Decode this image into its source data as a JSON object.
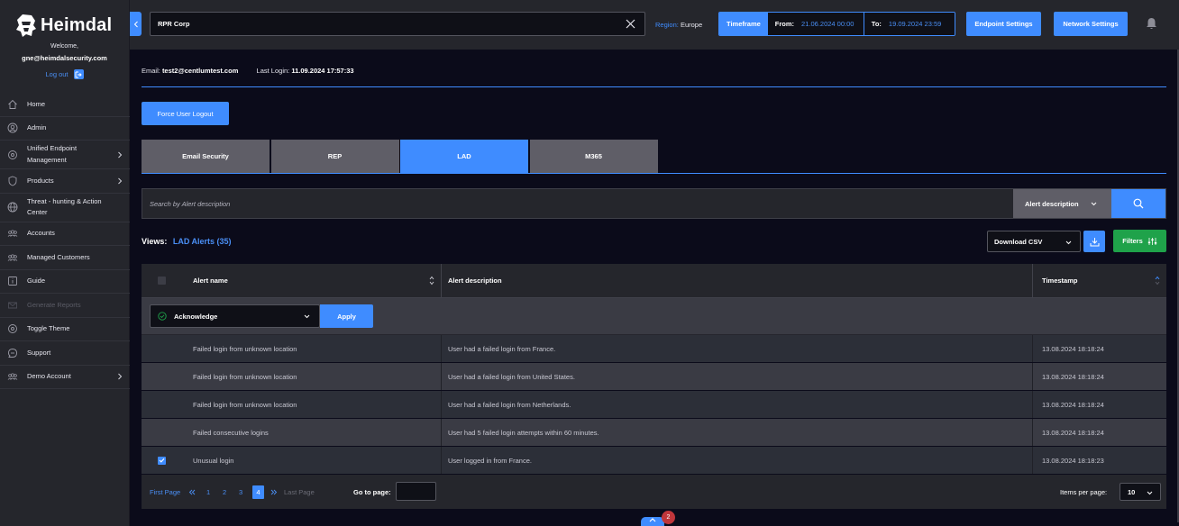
{
  "app": {
    "brand": "Heimdal",
    "welcome": "Welcome,",
    "email": "gne@heimdalsecurity.com",
    "logout": "Log out"
  },
  "nav": [
    {
      "label": "Home",
      "icon": "home-icon"
    },
    {
      "label": "Admin",
      "icon": "admin-icon"
    },
    {
      "label": "Unified Endpoint Management",
      "icon": "uem-icon",
      "chevron": true
    },
    {
      "label": "Products",
      "icon": "shield-icon",
      "chevron": true
    },
    {
      "label": "Threat - hunting & Action Center",
      "icon": "globe-icon"
    },
    {
      "label": "Accounts",
      "icon": "users-icon"
    },
    {
      "label": "Managed Customers",
      "icon": "customers-icon"
    },
    {
      "label": "Guide",
      "icon": "guide-icon"
    },
    {
      "label": "Generate Reports",
      "icon": "reports-icon",
      "disabled": true
    },
    {
      "label": "Toggle Theme",
      "icon": "theme-icon"
    },
    {
      "label": "Support",
      "icon": "support-icon"
    },
    {
      "label": "Demo Account",
      "icon": "demo-account-icon",
      "chevron": true
    }
  ],
  "topbar": {
    "company": "RPR Corp",
    "region_label": "Region:",
    "region_value": "Europe",
    "timeframe_label": "Timeframe",
    "from_label": "From:",
    "from_value": "21.06.2024 00:00",
    "to_label": "To:",
    "to_value": "19.09.2024 23:59",
    "endpoint_settings": "Endpoint Settings",
    "network_settings": "Network Settings"
  },
  "user_info": {
    "email_label": "Email:",
    "email_value": "test2@centlumtest.com",
    "last_login_label": "Last Login:",
    "last_login_value": "11.09.2024  17:57:33"
  },
  "force_logout": "Force User Logout",
  "tabs": [
    {
      "label": "Email Security",
      "active": false
    },
    {
      "label": "REP",
      "active": false
    },
    {
      "label": "LAD",
      "active": true
    },
    {
      "label": "M365",
      "active": false
    }
  ],
  "search": {
    "placeholder": "Search by Alert description",
    "field": "Alert description"
  },
  "views": {
    "label": "Views:",
    "value": "LAD Alerts (35)"
  },
  "download": {
    "label": "Download CSV"
  },
  "filters": {
    "label": "Filters"
  },
  "table": {
    "headers": {
      "name": "Alert name",
      "description": "Alert description",
      "timestamp": "Timestamp"
    },
    "action": {
      "selected": "Acknowledge",
      "apply": "Apply"
    },
    "rows": [
      {
        "name": "Failed login from unknown location",
        "description": "User had a failed login from France.",
        "timestamp": "13.08.2024  18:18:24",
        "checked": false
      },
      {
        "name": "Failed login from unknown location",
        "description": "User had a failed login from United States.",
        "timestamp": "13.08.2024  18:18:24",
        "checked": false
      },
      {
        "name": "Failed login from unknown location",
        "description": "User had a failed login from Netherlands.",
        "timestamp": "13.08.2024  18:18:24",
        "checked": false
      },
      {
        "name": "Failed consecutive logins",
        "description": "User had 5 failed login attempts within 60 minutes.",
        "timestamp": "13.08.2024  18:18:24",
        "checked": false
      },
      {
        "name": "Unusual login",
        "description": "User logged in from France.",
        "timestamp": "13.08.2024  18:18:23",
        "checked": true
      }
    ]
  },
  "pagination": {
    "first": "First Page",
    "pages": [
      "1",
      "2",
      "3",
      "4"
    ],
    "current": "4",
    "last": "Last Page",
    "goto_label": "Go to page:",
    "items_per_page_label": "Items per page:",
    "items_per_page": "10"
  },
  "notifications": {
    "count": "2"
  },
  "colors": {
    "accent": "#3f8cff",
    "success": "#1fa24a",
    "sidebar": "#25262c",
    "background": "#0b0b1a",
    "badge": "#c0363b"
  }
}
